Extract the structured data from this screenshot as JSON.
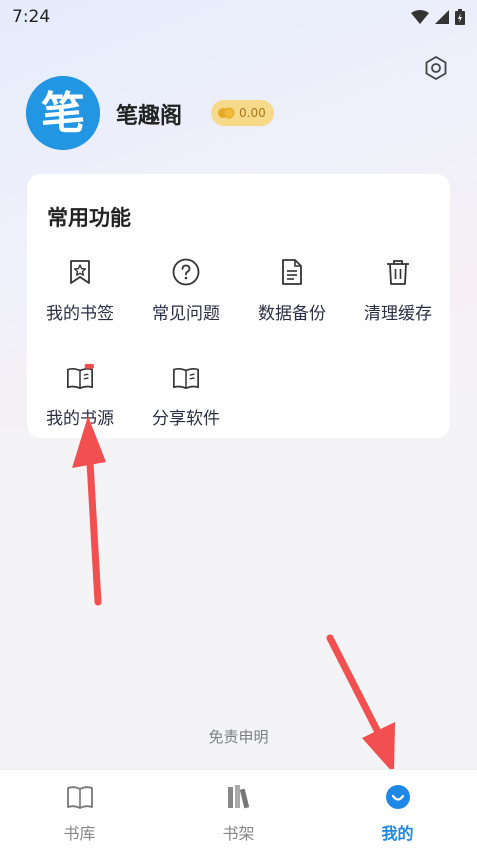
{
  "status_bar": {
    "time": "7:24"
  },
  "profile": {
    "avatar_char": "笔",
    "app_name": "笔趣阁",
    "coins": "0.00"
  },
  "card": {
    "title": "常用功能",
    "items": [
      {
        "label": "我的书签",
        "icon": "bookmark-icon"
      },
      {
        "label": "常见问题",
        "icon": "question-icon"
      },
      {
        "label": "数据备份",
        "icon": "document-icon"
      },
      {
        "label": "清理缓存",
        "icon": "trash-icon"
      },
      {
        "label": "我的书源",
        "icon": "book-source-icon"
      },
      {
        "label": "分享软件",
        "icon": "book-open-icon"
      }
    ]
  },
  "disclaimer": "免责申明",
  "tabs": [
    {
      "label": "书库",
      "icon": "book-icon",
      "active": false
    },
    {
      "label": "书架",
      "icon": "bookshelf-icon",
      "active": false
    },
    {
      "label": "我的",
      "icon": "profile-icon",
      "active": true
    }
  ],
  "colors": {
    "accent": "#1f88e5",
    "arrow": "#f25050",
    "coin": "#f7d98a"
  }
}
